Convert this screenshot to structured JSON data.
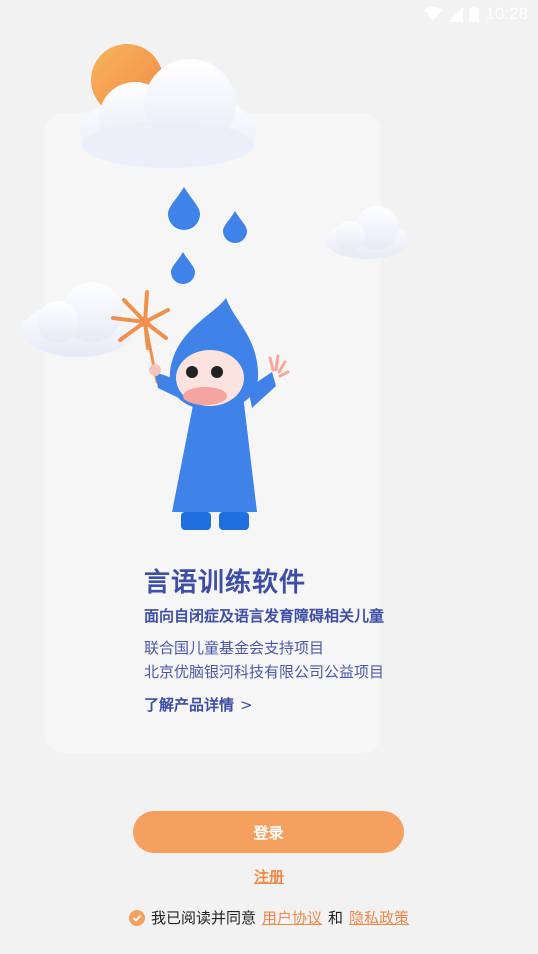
{
  "status_bar": {
    "time": "10:28"
  },
  "product": {
    "title": "言语训练软件",
    "subtitle": "面向自闭症及语言发育障碍相关儿童",
    "desc_line1": "联合国儿童基金会支持项目",
    "desc_line2": "北京优脑银河科技有限公司公益项目",
    "details_link": "了解产品详情",
    "details_chevron": ">"
  },
  "actions": {
    "login_label": "登录",
    "register_label": "注册"
  },
  "agreement": {
    "prefix": "我已阅读并同意",
    "user_agreement": "用户协议",
    "conjunction": "和",
    "privacy_policy": "隐私政策",
    "checked": true
  },
  "colors": {
    "accent": "#f5a05f",
    "link": "#f0894a",
    "title": "#3e4ea5",
    "raincoat": "#3f83e8"
  },
  "icons": [
    "wifi-icon",
    "signal-icon",
    "battery-icon",
    "check-icon",
    "chevron-right-icon"
  ]
}
